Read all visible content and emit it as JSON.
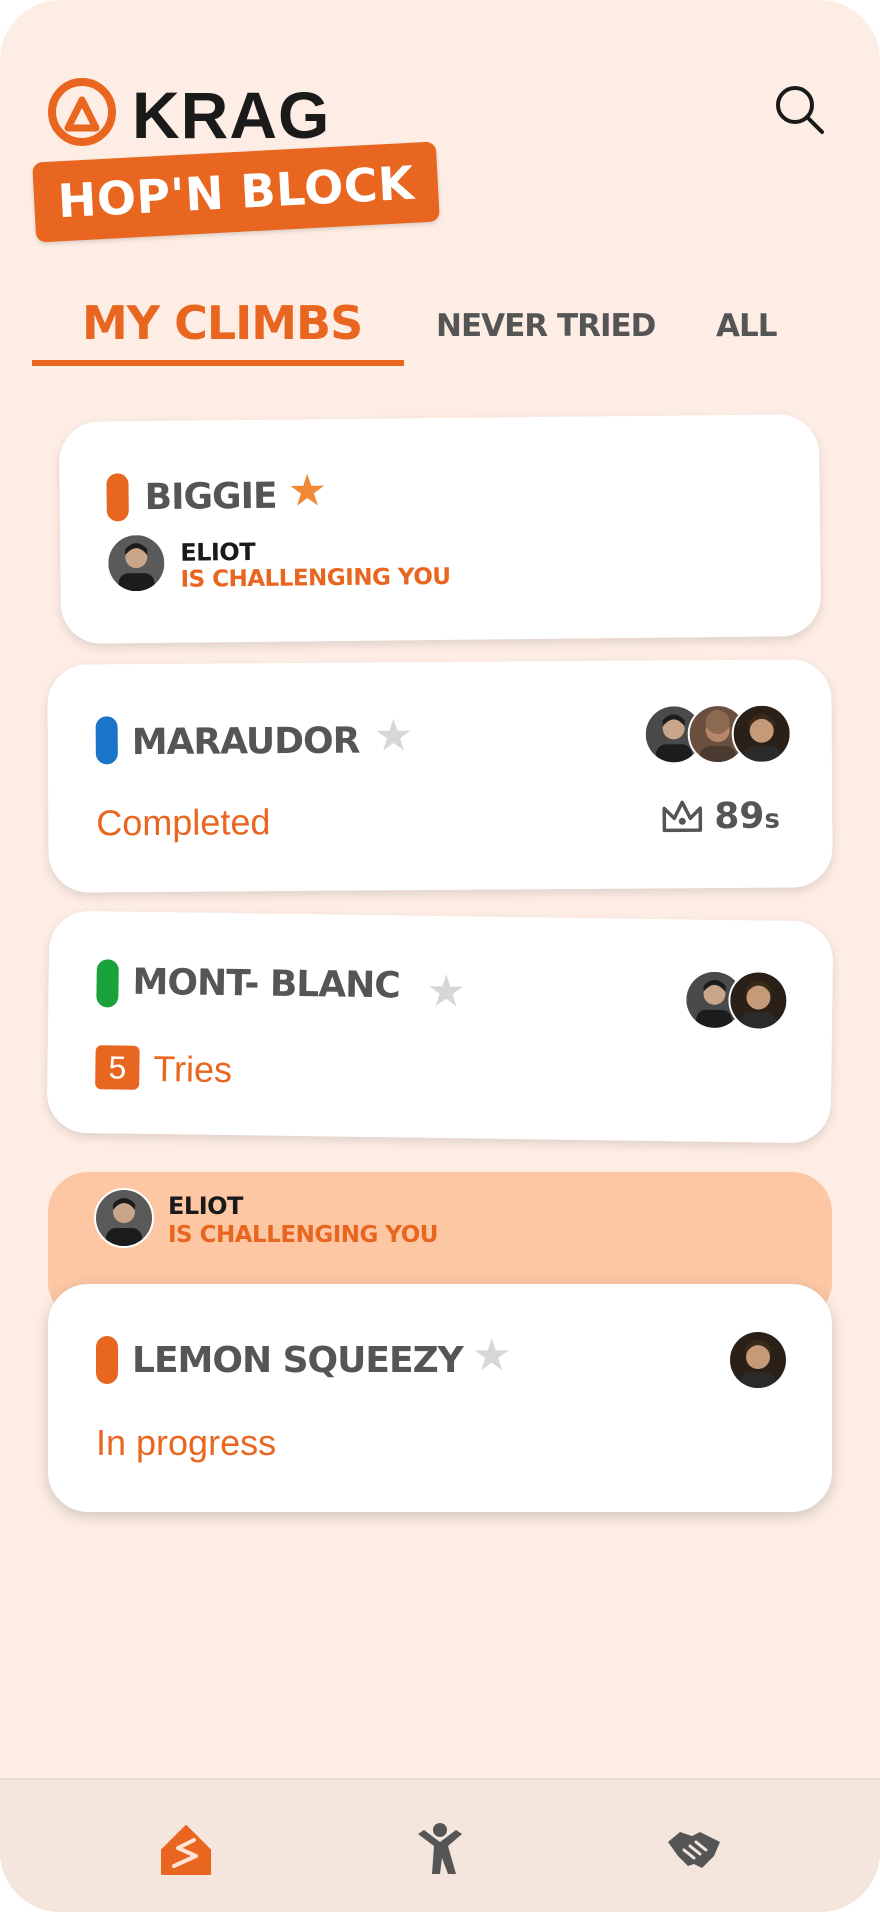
{
  "header": {
    "logo_text": "KRAG",
    "sticker_text": "HOP'N BLOCK"
  },
  "tabs": [
    {
      "label": "MY CLIMBS",
      "active": true
    },
    {
      "label": "NEVER TRIED",
      "active": false
    },
    {
      "label": "ALL",
      "active": false
    }
  ],
  "cards": [
    {
      "name": "BIGGIE",
      "color": "#e8661f",
      "favorite": true,
      "challenger": {
        "name": "ELIOT",
        "text": "IS CHALLENGING YOU"
      }
    },
    {
      "name": "MARAUDOR",
      "color": "#1a74c9",
      "favorite": false,
      "status": "Completed",
      "best_time": "89",
      "best_time_unit": "s",
      "participants": 3
    },
    {
      "name": "MONT- BLANC",
      "color": "#1aa33a",
      "favorite": false,
      "tries_count": "5",
      "tries_label": "Tries",
      "participants": 2
    },
    {
      "name": "LEMON SQUEEZY",
      "color": "#e8661f",
      "favorite": false,
      "status": "In progress",
      "participants": 1,
      "challenger": {
        "name": "ELIOT",
        "text": "IS CHALLENGING YOU"
      }
    }
  ],
  "icons": {
    "logo": "krag-logo-icon",
    "search": "search-icon",
    "crown": "crown-icon",
    "star": "star-icon",
    "nav": [
      "climb-wall-icon",
      "climber-icon",
      "handshake-icon"
    ]
  },
  "colors": {
    "accent": "#e8661f",
    "background": "#fdede4",
    "challenge_banner": "#fdc7a4",
    "blue_grade": "#1a74c9",
    "green_grade": "#1aa33a"
  }
}
